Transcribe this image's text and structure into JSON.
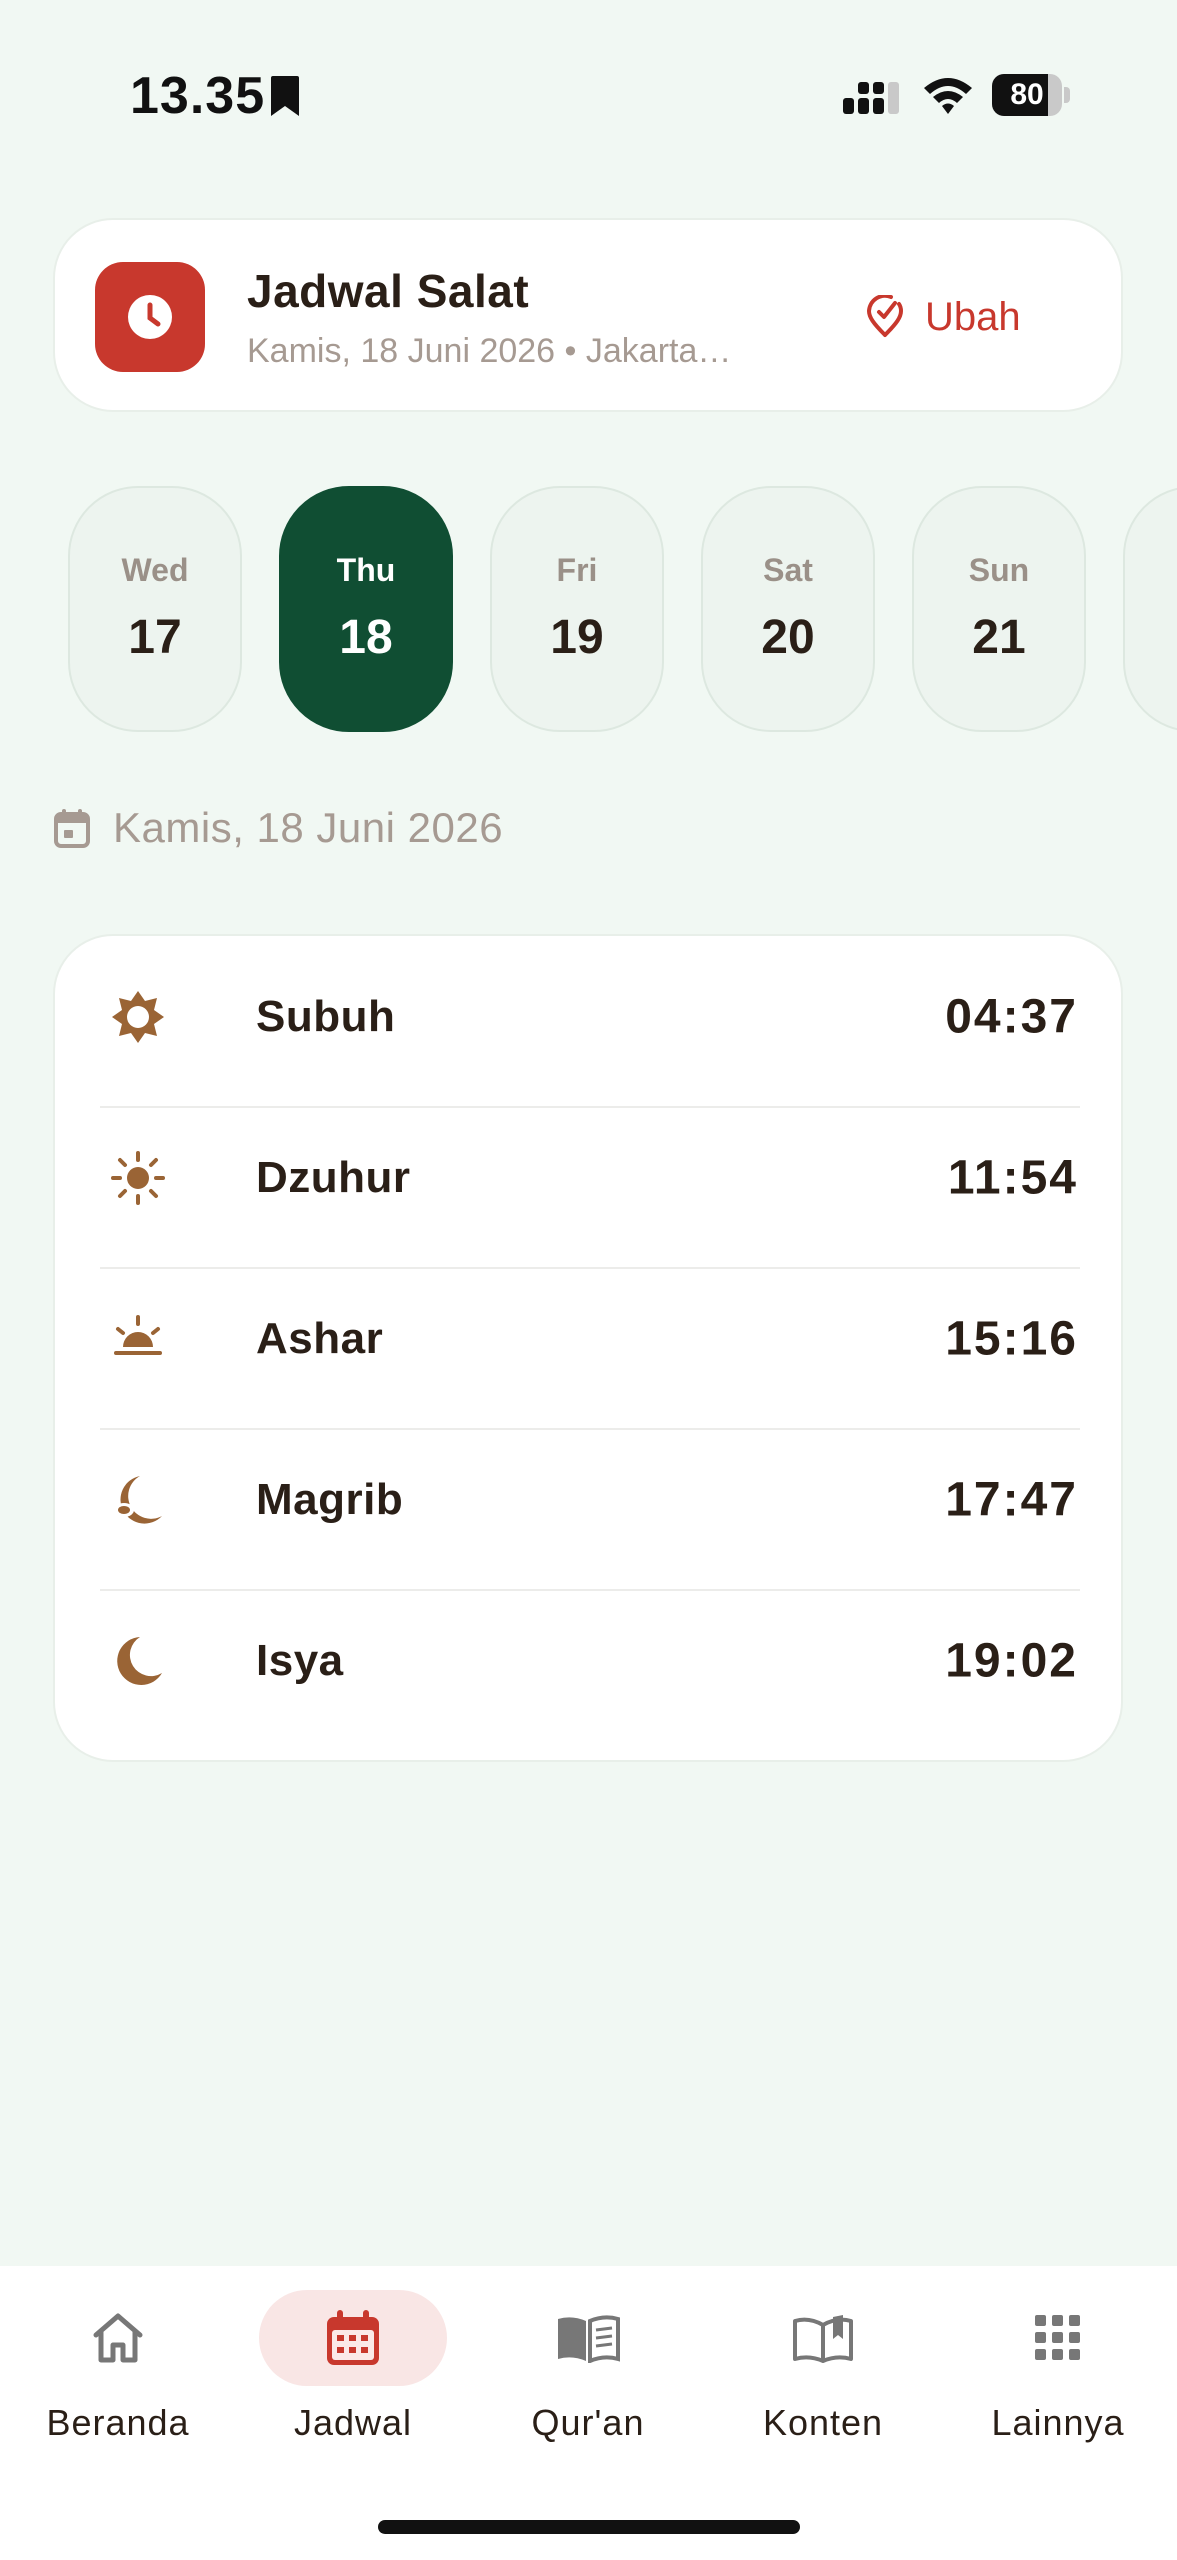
{
  "status": {
    "time": "13.35",
    "battery": "80",
    "battery_level": 0.8
  },
  "header": {
    "title": "Jadwal Salat",
    "subtitle": "Kamis, 18 Juni 2026 • Jakarta…",
    "change_label": "Ubah"
  },
  "days": [
    {
      "name": "Wed",
      "num": "17",
      "active": false
    },
    {
      "name": "Thu",
      "num": "18",
      "active": true
    },
    {
      "name": "Fri",
      "num": "19",
      "active": false
    },
    {
      "name": "Sat",
      "num": "20",
      "active": false
    },
    {
      "name": "Sun",
      "num": "21",
      "active": false
    }
  ],
  "selected_date": "Kamis, 18 Juni 2026",
  "prayers": [
    {
      "name": "Subuh",
      "time": "04:37",
      "icon": "sun-outline-icon"
    },
    {
      "name": "Dzuhur",
      "time": "11:54",
      "icon": "sun-icon"
    },
    {
      "name": "Ashar",
      "time": "15:16",
      "icon": "sunset-icon"
    },
    {
      "name": "Magrib",
      "time": "17:47",
      "icon": "moon-cloud-icon"
    },
    {
      "name": "Isya",
      "time": "19:02",
      "icon": "moon-icon"
    }
  ],
  "nav": [
    {
      "label": "Beranda",
      "icon": "home-icon",
      "active": false
    },
    {
      "label": "Jadwal",
      "icon": "calendar-icon",
      "active": true
    },
    {
      "label": "Qur'an",
      "icon": "book-icon",
      "active": false
    },
    {
      "label": "Konten",
      "icon": "open-book-icon",
      "active": false
    },
    {
      "label": "Lainnya",
      "icon": "grid-icon",
      "active": false
    }
  ],
  "colors": {
    "accent_red": "#c8382d",
    "accent_green": "#104e33",
    "icon_brown": "#9a6435",
    "background": "#f1f8f3"
  }
}
